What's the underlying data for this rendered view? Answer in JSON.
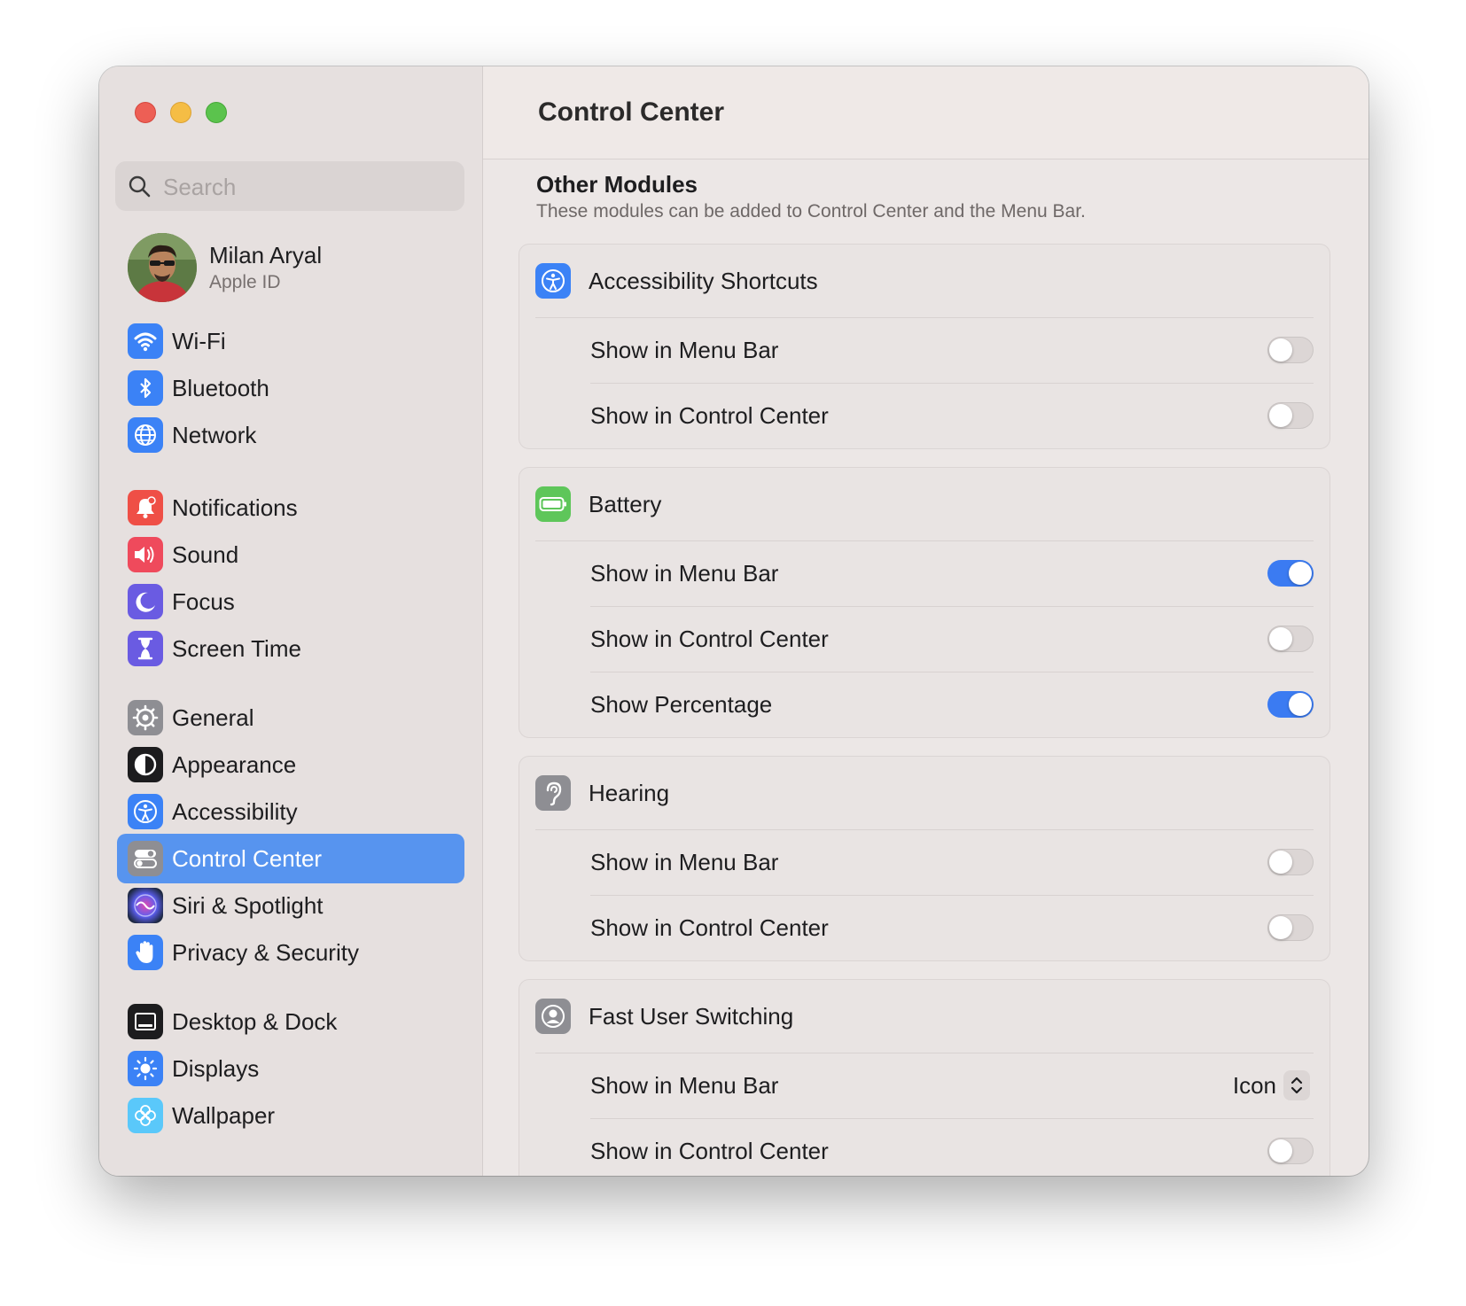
{
  "window": {
    "title": "Control Center"
  },
  "search": {
    "placeholder": "Search"
  },
  "profile": {
    "name": "Milan Aryal",
    "subtitle": "Apple ID"
  },
  "sidebar": {
    "items": [
      {
        "label": "Wi-Fi",
        "icon": "wifi-icon",
        "color": "#3b82f6"
      },
      {
        "label": "Bluetooth",
        "icon": "bluetooth-icon",
        "color": "#3b82f6"
      },
      {
        "label": "Network",
        "icon": "globe-icon",
        "color": "#3b82f6"
      },
      {
        "label": "Notifications",
        "icon": "bell-icon",
        "color": "#ef4f46"
      },
      {
        "label": "Sound",
        "icon": "speaker-icon",
        "color": "#ef4a5c"
      },
      {
        "label": "Focus",
        "icon": "moon-icon",
        "color": "#6a5be2"
      },
      {
        "label": "Screen Time",
        "icon": "hourglass-icon",
        "color": "#6a5be2"
      },
      {
        "label": "General",
        "icon": "gear-icon",
        "color": "#8e8e93"
      },
      {
        "label": "Appearance",
        "icon": "appearance-icon",
        "color": "#1c1c1e"
      },
      {
        "label": "Accessibility",
        "icon": "accessibility-icon",
        "color": "#3b82f6"
      },
      {
        "label": "Control Center",
        "icon": "control-center-icon",
        "color": "#8e8e93"
      },
      {
        "label": "Siri & Spotlight",
        "icon": "siri-icon",
        "color": "#2b2b40"
      },
      {
        "label": "Privacy & Security",
        "icon": "hand-icon",
        "color": "#3b82f6"
      },
      {
        "label": "Desktop & Dock",
        "icon": "dock-icon",
        "color": "#1c1c1e"
      },
      {
        "label": "Displays",
        "icon": "sun-icon",
        "color": "#3b82f6"
      },
      {
        "label": "Wallpaper",
        "icon": "flower-icon",
        "color": "#5ac8fa"
      }
    ],
    "selected": "Control Center"
  },
  "main": {
    "section_title": "Other Modules",
    "section_desc": "These modules can be added to Control Center and the Menu Bar.",
    "modules": [
      {
        "name": "Accessibility Shortcuts",
        "icon": "accessibility-icon",
        "rows": [
          {
            "label": "Show in Menu Bar",
            "type": "toggle",
            "on": false
          },
          {
            "label": "Show in Control Center",
            "type": "toggle",
            "on": false
          }
        ]
      },
      {
        "name": "Battery",
        "icon": "battery-icon",
        "rows": [
          {
            "label": "Show in Menu Bar",
            "type": "toggle",
            "on": true
          },
          {
            "label": "Show in Control Center",
            "type": "toggle",
            "on": false
          },
          {
            "label": "Show Percentage",
            "type": "toggle",
            "on": true
          }
        ]
      },
      {
        "name": "Hearing",
        "icon": "ear-icon",
        "rows": [
          {
            "label": "Show in Menu Bar",
            "type": "toggle",
            "on": false
          },
          {
            "label": "Show in Control Center",
            "type": "toggle",
            "on": false
          }
        ]
      },
      {
        "name": "Fast User Switching",
        "icon": "user-icon",
        "rows": [
          {
            "label": "Show in Menu Bar",
            "type": "popup",
            "value": "Icon"
          },
          {
            "label": "Show in Control Center",
            "type": "toggle",
            "on": false
          }
        ]
      }
    ]
  },
  "colors": {
    "accent": "#3b7bf2",
    "selection": "#5794ef"
  }
}
